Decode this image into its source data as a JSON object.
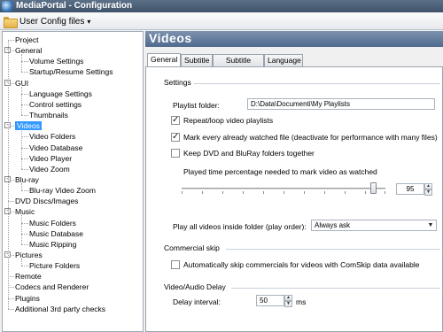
{
  "window": {
    "title": "MediaPortal - Configuration"
  },
  "toolbar": {
    "user_config_label": "User Config files",
    "user_config_caret": "▾"
  },
  "tree": {
    "items": [
      {
        "label": "Project",
        "level": 0,
        "expander": ""
      },
      {
        "label": "General",
        "level": 0,
        "expander": "-"
      },
      {
        "label": "Volume Settings",
        "level": 1,
        "expander": ""
      },
      {
        "label": "Startup/Resume Settings",
        "level": 1,
        "expander": ""
      },
      {
        "label": "GUI",
        "level": 0,
        "expander": "-"
      },
      {
        "label": "Language Settings",
        "level": 1,
        "expander": ""
      },
      {
        "label": "Control settings",
        "level": 1,
        "expander": ""
      },
      {
        "label": "Thumbnails",
        "level": 1,
        "expander": ""
      },
      {
        "label": "Videos",
        "level": 0,
        "expander": "-",
        "selected": true
      },
      {
        "label": "Video Folders",
        "level": 1,
        "expander": ""
      },
      {
        "label": "Video Database",
        "level": 1,
        "expander": ""
      },
      {
        "label": "Video Player",
        "level": 1,
        "expander": ""
      },
      {
        "label": "Video Zoom",
        "level": 1,
        "expander": ""
      },
      {
        "label": "Blu-ray",
        "level": 0,
        "expander": "-"
      },
      {
        "label": "Blu-ray Video Zoom",
        "level": 1,
        "expander": ""
      },
      {
        "label": "DVD Discs/Images",
        "level": 0,
        "expander": ""
      },
      {
        "label": "Music",
        "level": 0,
        "expander": "-"
      },
      {
        "label": "Music Folders",
        "level": 1,
        "expander": ""
      },
      {
        "label": "Music Database",
        "level": 1,
        "expander": ""
      },
      {
        "label": "Music Ripping",
        "level": 1,
        "expander": ""
      },
      {
        "label": "Pictures",
        "level": 0,
        "expander": "-"
      },
      {
        "label": "Picture Folders",
        "level": 1,
        "expander": ""
      },
      {
        "label": "Remote",
        "level": 0,
        "expander": ""
      },
      {
        "label": "Codecs and Renderer",
        "level": 0,
        "expander": ""
      },
      {
        "label": "Plugins",
        "level": 0,
        "expander": ""
      },
      {
        "label": "Additional 3rd party checks",
        "level": 0,
        "expander": ""
      }
    ]
  },
  "main": {
    "header_title": "Videos",
    "tabs": [
      {
        "label": "General",
        "active": true
      },
      {
        "label": "Subtitle"
      },
      {
        "label": "Subtitle (cont)"
      },
      {
        "label": "Language"
      }
    ],
    "settings": {
      "group_title": "Settings",
      "playlist_folder_label": "Playlist folder:",
      "playlist_folder_value": "D:\\Data\\Documenti\\My Playlists",
      "repeat_loop_label": "Repeat/loop video playlists",
      "repeat_loop_checked": true,
      "mark_watched_label": "Mark every already watched file (deactivate for performance with many files)",
      "mark_watched_checked": true,
      "keep_dvd_label": "Keep DVD and BluRay folders together",
      "keep_dvd_checked": false,
      "played_percentage_label": "Played time percentage needed to mark video as watched",
      "played_percentage_value": "95",
      "play_all_label": "Play all videos inside folder (play order):",
      "play_all_value": "Always ask"
    },
    "commercial_skip": {
      "group_title": "Commercial skip",
      "auto_skip_label": "Automatically skip commercials for videos with ComSkip data available",
      "auto_skip_checked": false
    },
    "av_delay": {
      "group_title": "Video/Audio Delay",
      "delay_label": "Delay interval:",
      "delay_value": "50",
      "delay_unit": "ms"
    }
  },
  "colors": {
    "selection": "#3399ff",
    "header_band": "#5f7898",
    "title_bar": "#4a5e77"
  }
}
